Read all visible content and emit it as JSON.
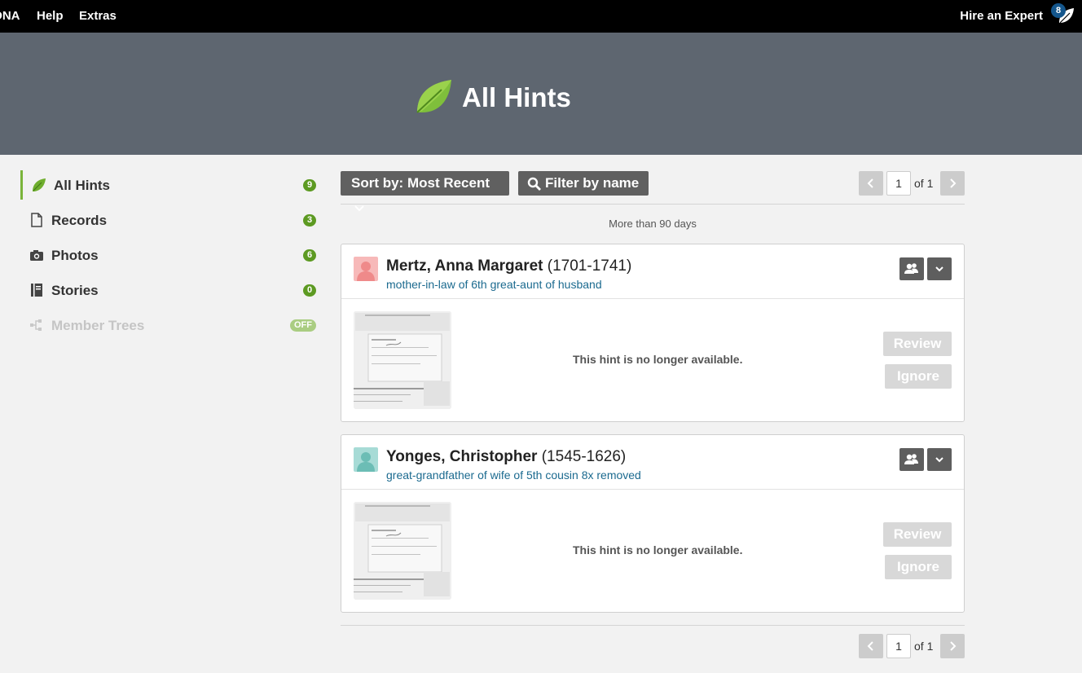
{
  "topnav": {
    "items": [
      "DNA",
      "Help",
      "Extras"
    ],
    "hire_expert": "Hire an Expert",
    "notification_count": "8"
  },
  "header": {
    "title": "All Hints"
  },
  "sidebar": {
    "items": [
      {
        "label": "All Hints",
        "count": "9",
        "icon": "leaf-icon",
        "active": true
      },
      {
        "label": "Records",
        "count": "3",
        "icon": "document-icon"
      },
      {
        "label": "Photos",
        "count": "6",
        "icon": "camera-icon"
      },
      {
        "label": "Stories",
        "count": "0",
        "icon": "book-icon"
      },
      {
        "label": "Member Trees",
        "count": "OFF",
        "icon": "tree-icon",
        "disabled": true
      }
    ]
  },
  "toolbar": {
    "sort_label": "Sort by: Most Recent",
    "filter_label": "Filter by name"
  },
  "pager": {
    "page": "1",
    "of_label": "of 1"
  },
  "section_label": "More than 90 days",
  "hints": [
    {
      "name": "Mertz, Anna Margaret",
      "dates": "(1701-1741)",
      "relation": "mother-in-law of 6th great-aunt of husband",
      "gender": "female",
      "message": "This hint is no longer available.",
      "review": "Review",
      "ignore": "Ignore"
    },
    {
      "name": "Yonges, Christopher",
      "dates": "(1545-1626)",
      "relation": "great-grandfather of wife of 5th cousin 8x removed",
      "gender": "male",
      "message": "This hint is no longer available.",
      "review": "Review",
      "ignore": "Ignore"
    }
  ],
  "colors": {
    "accent_green": "#5d9a22",
    "header_bg": "#5e6670",
    "link_blue": "#1b6a8f",
    "female_avatar": "#f3a6a6",
    "male_avatar": "#8fd0cb"
  }
}
